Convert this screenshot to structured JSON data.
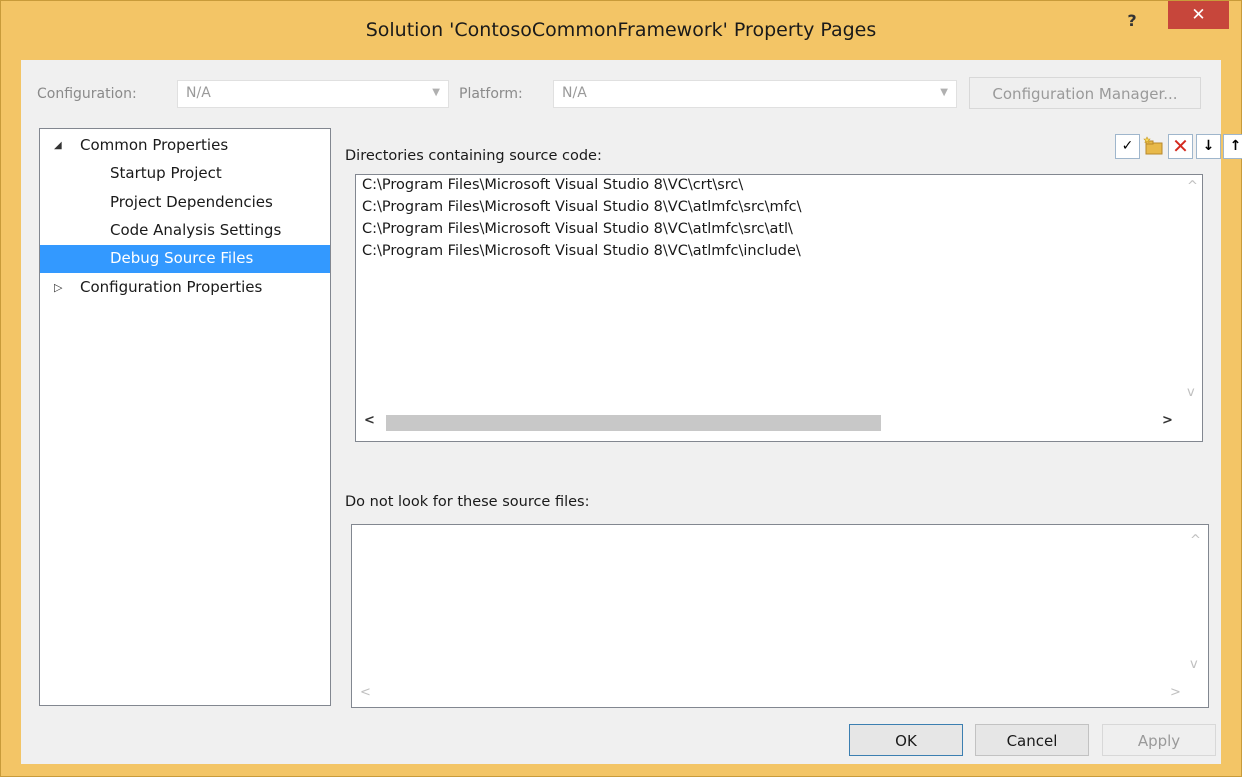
{
  "window": {
    "title": "Solution 'ContosoCommonFramework' Property Pages",
    "help": "?",
    "close": "✕"
  },
  "toolbar": {
    "configuration_label": "Configuration:",
    "configuration_value": "N/A",
    "platform_label": "Platform:",
    "platform_value": "N/A",
    "config_manager_label": "Configuration Manager..."
  },
  "tree": {
    "common_properties": "Common Properties",
    "items": [
      "Startup Project",
      "Project Dependencies",
      "Code Analysis Settings",
      "Debug Source Files"
    ],
    "selected_index": 3,
    "configuration_properties": "Configuration Properties",
    "expanded_glyph": "◢",
    "collapsed_glyph": "▷"
  },
  "source_dirs": {
    "label": "Directories containing source code:",
    "paths": [
      "C:\\Program Files\\Microsoft Visual Studio 8\\VC\\crt\\src\\",
      "C:\\Program Files\\Microsoft Visual Studio 8\\VC\\atlmfc\\src\\mfc\\",
      "C:\\Program Files\\Microsoft Visual Studio 8\\VC\\atlmfc\\src\\atl\\",
      "C:\\Program Files\\Microsoft Visual Studio 8\\VC\\atlmfc\\include\\"
    ],
    "toolbar_icons": {
      "check": "✓",
      "new_folder": "",
      "delete": "✕",
      "move_down": "↓",
      "move_up": "↑"
    }
  },
  "exclude": {
    "label": "Do not look for these source files:"
  },
  "scroll": {
    "left": "<",
    "right": ">",
    "up": "^",
    "down": "v"
  },
  "buttons": {
    "ok": "OK",
    "cancel": "Cancel",
    "apply": "Apply"
  },
  "colors": {
    "frame": "#f3c566",
    "close": "#c7463b",
    "selection": "#3399ff",
    "delete_icon": "#d42a1f"
  }
}
